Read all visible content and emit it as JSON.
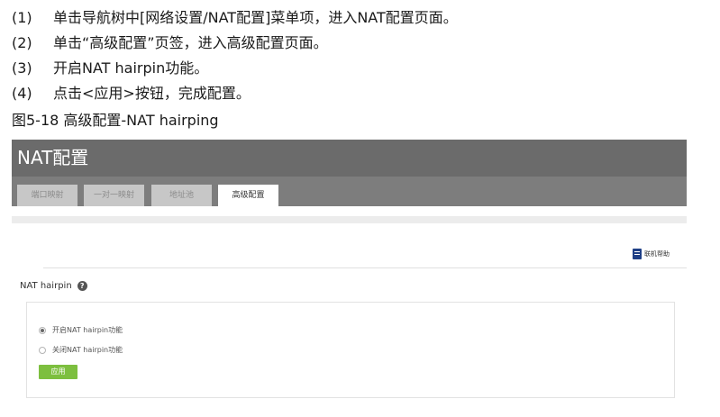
{
  "steps": [
    {
      "num": "(1)",
      "text": "单击导航树中[网络设置/NAT配置]菜单项，进入NAT配置页面。"
    },
    {
      "num": "(2)",
      "text": "单击“高级配置”页签，进入高级配置页面。"
    },
    {
      "num": "(3)",
      "text": "开启NAT hairpin功能。"
    },
    {
      "num": "(4)",
      "text": "点击<应用>按钮，完成配置。"
    }
  ],
  "figure_caption": "图5-18 高级配置-NAT hairping",
  "screenshot": {
    "title": "NAT配置",
    "tabs": [
      {
        "label": "端口映射",
        "active": false
      },
      {
        "label": "一对一映射",
        "active": false
      },
      {
        "label": "地址池",
        "active": false
      },
      {
        "label": "高级配置",
        "active": true
      }
    ],
    "help_label": "联机帮助",
    "section_title": "NAT hairpin",
    "options": [
      {
        "label": "开启NAT hairpin功能",
        "checked": true
      },
      {
        "label": "关闭NAT hairpin功能",
        "checked": false
      }
    ],
    "apply_label": "应用",
    "colors": {
      "header": "#6b6b6b",
      "tabbar": "#7d7d7d",
      "apply": "#7dbf3f",
      "help_icon": "#1e3f86"
    }
  }
}
